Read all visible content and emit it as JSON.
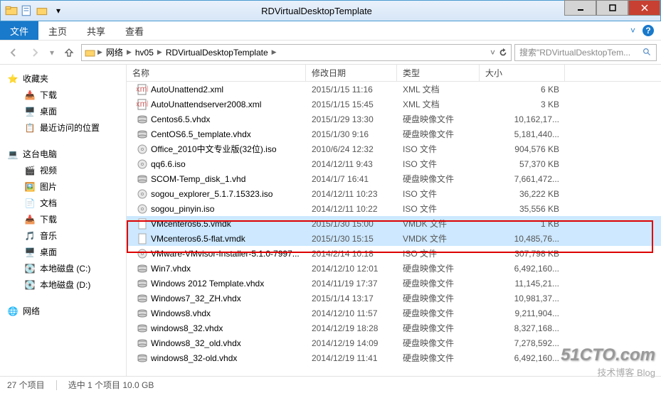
{
  "window": {
    "title": "RDVirtualDesktopTemplate"
  },
  "ribbon": {
    "file": "文件",
    "home": "主页",
    "share": "共享",
    "view": "查看"
  },
  "breadcrumbs": {
    "net": "网络",
    "host": "hv05",
    "folder": "RDVirtualDesktopTemplate",
    "search_placeholder": "搜索\"RDVirtualDesktopTem..."
  },
  "nav": {
    "favorites": "收藏夹",
    "downloads": "下载",
    "desktop": "桌面",
    "recent": "最近访问的位置",
    "thispc": "这台电脑",
    "videos": "视频",
    "pictures": "图片",
    "documents": "文档",
    "downloads2": "下载",
    "music": "音乐",
    "desktop2": "桌面",
    "diskc": "本地磁盘 (C:)",
    "diskd": "本地磁盘 (D:)",
    "network": "网络"
  },
  "columns": {
    "name": "名称",
    "date": "修改日期",
    "type": "类型",
    "size": "大小"
  },
  "files": [
    {
      "icon": "xml",
      "name": "AutoUnattend2.xml",
      "date": "2015/1/15 11:16",
      "type": "XML 文档",
      "size": "6 KB"
    },
    {
      "icon": "xml",
      "name": "AutoUnattendserver2008.xml",
      "date": "2015/1/15 15:45",
      "type": "XML 文档",
      "size": "3 KB"
    },
    {
      "icon": "disk",
      "name": "Centos6.5.vhdx",
      "date": "2015/1/29 13:30",
      "type": "硬盘映像文件",
      "size": "10,162,17..."
    },
    {
      "icon": "disk",
      "name": "CentOS6.5_template.vhdx",
      "date": "2015/1/30 9:16",
      "type": "硬盘映像文件",
      "size": "5,181,440..."
    },
    {
      "icon": "iso",
      "name": "Office_2010中文专业版(32位).iso",
      "date": "2010/6/24 12:32",
      "type": "ISO 文件",
      "size": "904,576 KB"
    },
    {
      "icon": "iso",
      "name": "qq6.6.iso",
      "date": "2014/12/11 9:43",
      "type": "ISO 文件",
      "size": "57,370 KB"
    },
    {
      "icon": "disk",
      "name": "SCOM-Temp_disk_1.vhd",
      "date": "2014/1/7 16:41",
      "type": "硬盘映像文件",
      "size": "7,661,472..."
    },
    {
      "icon": "iso",
      "name": "sogou_explorer_5.1.7.15323.iso",
      "date": "2014/12/11 10:23",
      "type": "ISO 文件",
      "size": "36,222 KB"
    },
    {
      "icon": "iso",
      "name": "sogou_pinyin.iso",
      "date": "2014/12/11 10:22",
      "type": "ISO 文件",
      "size": "35,556 KB"
    },
    {
      "icon": "file",
      "name": "VMcenteros6.5.vmdk",
      "date": "2015/1/30 15:00",
      "type": "VMDK 文件",
      "size": "1 KB",
      "selected": true
    },
    {
      "icon": "file",
      "name": "VMcenteros6.5-flat.vmdk",
      "date": "2015/1/30 15:15",
      "type": "VMDK 文件",
      "size": "10,485,76...",
      "selected": true
    },
    {
      "icon": "iso",
      "name": "VMware-VMvisor-Installer-5.1.0-7997...",
      "date": "2014/2/14 10:18",
      "type": "ISO 文件",
      "size": "307,798 KB"
    },
    {
      "icon": "disk",
      "name": "Win7.vhdx",
      "date": "2014/12/10 12:01",
      "type": "硬盘映像文件",
      "size": "6,492,160..."
    },
    {
      "icon": "disk",
      "name": "Windows 2012 Template.vhdx",
      "date": "2014/11/19 17:37",
      "type": "硬盘映像文件",
      "size": "11,145,21..."
    },
    {
      "icon": "disk",
      "name": "Windows7_32_ZH.vhdx",
      "date": "2015/1/14 13:17",
      "type": "硬盘映像文件",
      "size": "10,981,37..."
    },
    {
      "icon": "disk",
      "name": "Windows8.vhdx",
      "date": "2014/12/10 11:57",
      "type": "硬盘映像文件",
      "size": "9,211,904..."
    },
    {
      "icon": "disk",
      "name": "windows8_32.vhdx",
      "date": "2014/12/19 18:28",
      "type": "硬盘映像文件",
      "size": "8,327,168..."
    },
    {
      "icon": "disk",
      "name": "Windows8_32_old.vhdx",
      "date": "2014/12/19 14:09",
      "type": "硬盘映像文件",
      "size": "7,278,592..."
    },
    {
      "icon": "disk",
      "name": "windows8_32-old.vhdx",
      "date": "2014/12/19 11:41",
      "type": "硬盘映像文件",
      "size": "6,492,160..."
    }
  ],
  "status": {
    "count": "27 个项目",
    "selection": "选中 1 个项目 10.0 GB"
  },
  "watermark": {
    "big": "51CTO.com",
    "small": "技术博客  Blog"
  }
}
